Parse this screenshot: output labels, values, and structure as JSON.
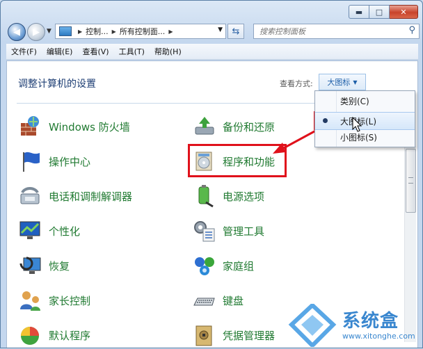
{
  "window": {
    "buttons": {
      "minimize": "▬",
      "maximize": "□",
      "close": "✕"
    }
  },
  "nav": {
    "back": "◀",
    "forward": "▶",
    "breadcrumb": [
      "控制...",
      "所有控制面..."
    ],
    "refresh_icon": "refresh-icon",
    "search_placeholder": "搜索控制面板"
  },
  "menu": [
    "文件(F)",
    "编辑(E)",
    "查看(V)",
    "工具(T)",
    "帮助(H)"
  ],
  "content": {
    "heading": "调整计算机的设置",
    "view_by_label": "查看方式:",
    "view_by_value": "大图标",
    "items_left": [
      {
        "label": "Windows 防火墙",
        "icon": "firewall-icon"
      },
      {
        "label": "操作中心",
        "icon": "action-center-flag-icon"
      },
      {
        "label": "电话和调制解调器",
        "icon": "phone-modem-icon"
      },
      {
        "label": "个性化",
        "icon": "personalization-icon"
      },
      {
        "label": "恢复",
        "icon": "recovery-icon"
      },
      {
        "label": "家长控制",
        "icon": "parental-controls-icon"
      },
      {
        "label": "默认程序",
        "icon": "default-programs-icon"
      }
    ],
    "items_right": [
      {
        "label": "备份和还原",
        "icon": "backup-restore-icon"
      },
      {
        "label": "程序和功能",
        "icon": "programs-features-icon"
      },
      {
        "label": "电源选项",
        "icon": "power-options-icon"
      },
      {
        "label": "管理工具",
        "icon": "admin-tools-icon"
      },
      {
        "label": "家庭组",
        "icon": "homegroup-icon"
      },
      {
        "label": "键盘",
        "icon": "keyboard-icon"
      },
      {
        "label": "凭据管理器",
        "icon": "credential-manager-icon"
      }
    ]
  },
  "dropdown": {
    "items": [
      "类别(C)",
      "大图标(L)",
      "小图标(S)"
    ],
    "selected": "大图标(L)"
  },
  "watermark": {
    "name": "系统盒",
    "url": "www.xitonghe.com"
  },
  "colors": {
    "annotation_red": "#e0111b",
    "link_green": "#207a31",
    "heading_blue": "#1c3d73"
  }
}
